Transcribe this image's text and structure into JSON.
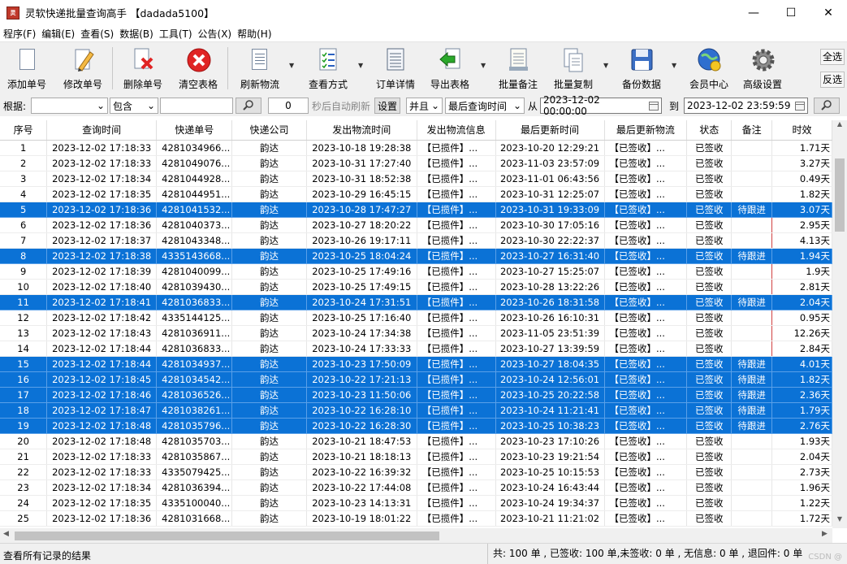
{
  "window": {
    "title": "灵软快递批量查询高手 【dadada5100】",
    "app_icon": "app-icon",
    "buttons": {
      "minimize": "—",
      "maximize": "☐",
      "close": "✕"
    }
  },
  "menu": [
    "程序(F)",
    "编辑(E)",
    "查看(S)",
    "数据(B)",
    "工具(T)",
    "公告(X)",
    "帮助(H)"
  ],
  "toolbar": {
    "buttons": [
      {
        "label": "添加单号",
        "icon": "add-document-icon"
      },
      {
        "label": "修改单号",
        "icon": "edit-pencil-icon"
      },
      {
        "label": "删除单号",
        "icon": "delete-document-icon"
      },
      {
        "label": "清空表格",
        "icon": "clear-red-x-icon"
      },
      {
        "label": "刷新物流",
        "icon": "refresh-list-icon"
      },
      {
        "label": "查看方式",
        "icon": "checklist-icon"
      },
      {
        "label": "订单详情",
        "icon": "order-detail-icon"
      },
      {
        "label": "导出表格",
        "icon": "export-arrow-icon"
      },
      {
        "label": "批量备注",
        "icon": "notes-icon"
      },
      {
        "label": "批量复制",
        "icon": "copy-icon"
      },
      {
        "label": "备份数据",
        "icon": "floppy-disk-icon"
      },
      {
        "label": "会员中心",
        "icon": "globe-member-icon"
      },
      {
        "label": "高级设置",
        "icon": "gear-icon"
      }
    ],
    "side_buttons": {
      "select_all": "全选",
      "invert": "反选"
    }
  },
  "filter": {
    "basis_label": "根据:",
    "basis_value": "",
    "match_mode": "包含",
    "search_text": "",
    "refresh_seconds": "0",
    "auto_refresh_label": "秒后自动刷新",
    "settings_button": "设置",
    "logic": "并且",
    "field": "最后查询时间",
    "from_label": "从",
    "from_value": "2023-12-02 00:00:00",
    "to_label": "到",
    "to_value": "2023-12-02 23:59:59"
  },
  "table": {
    "columns": [
      "序号",
      "查询时间",
      "快递单号",
      "快递公司",
      "发出物流时间",
      "发出物流信息",
      "最后更新时间",
      "最后更新物流",
      "状态",
      "备注",
      "时效"
    ],
    "rows": [
      {
        "no": "1",
        "query": "2023-12-02 17:18:33",
        "track": "4281034966...",
        "co": "韵达",
        "sent": "2023-10-18 19:28:38",
        "sinfo": "【已揽件】...",
        "upd": "2023-10-20 12:29:21",
        "uinfo": "【已签收】...",
        "status": "已签收",
        "note": "",
        "age": "1.71天",
        "sel": false
      },
      {
        "no": "2",
        "query": "2023-12-02 17:18:33",
        "track": "4281049076...",
        "co": "韵达",
        "sent": "2023-10-31 17:27:40",
        "sinfo": "【已揽件】...",
        "upd": "2023-11-03 23:57:09",
        "uinfo": "【已签收】...",
        "status": "已签收",
        "note": "",
        "age": "3.27天",
        "sel": false
      },
      {
        "no": "3",
        "query": "2023-12-02 17:18:34",
        "track": "4281044928...",
        "co": "韵达",
        "sent": "2023-10-31 18:52:38",
        "sinfo": "【已揽件】...",
        "upd": "2023-11-01 06:43:56",
        "uinfo": "【已签收】...",
        "status": "已签收",
        "note": "",
        "age": "0.49天",
        "sel": false
      },
      {
        "no": "4",
        "query": "2023-12-02 17:18:35",
        "track": "4281044951...",
        "co": "韵达",
        "sent": "2023-10-29 16:45:15",
        "sinfo": "【已揽件】...",
        "upd": "2023-10-31 12:25:07",
        "uinfo": "【已签收】...",
        "status": "已签收",
        "note": "",
        "age": "1.82天",
        "sel": false
      },
      {
        "no": "5",
        "query": "2023-12-02 17:18:36",
        "track": "4281041532...",
        "co": "韵达",
        "sent": "2023-10-28 17:47:27",
        "sinfo": "【已揽件】...",
        "upd": "2023-10-31 19:33:09",
        "uinfo": "【已签收】...",
        "status": "已签收",
        "note": "待跟进",
        "age": "3.07天",
        "sel": true
      },
      {
        "no": "6",
        "query": "2023-12-02 17:18:36",
        "track": "4281040373...",
        "co": "韵达",
        "sent": "2023-10-27 18:20:22",
        "sinfo": "【已揽件】...",
        "upd": "2023-10-30 17:05:16",
        "uinfo": "【已签收】...",
        "status": "已签收",
        "note": "",
        "age": "2.95天",
        "sel": false
      },
      {
        "no": "7",
        "query": "2023-12-02 17:18:37",
        "track": "4281043348...",
        "co": "韵达",
        "sent": "2023-10-26 19:17:11",
        "sinfo": "【已揽件】...",
        "upd": "2023-10-30 22:22:37",
        "uinfo": "【已签收】...",
        "status": "已签收",
        "note": "",
        "age": "4.13天",
        "sel": false
      },
      {
        "no": "8",
        "query": "2023-12-02 17:18:38",
        "track": "4335143668...",
        "co": "韵达",
        "sent": "2023-10-25 18:04:24",
        "sinfo": "【已揽件】...",
        "upd": "2023-10-27 16:31:40",
        "uinfo": "【已签收】...",
        "status": "已签收",
        "note": "待跟进",
        "age": "1.94天",
        "sel": true
      },
      {
        "no": "9",
        "query": "2023-12-02 17:18:39",
        "track": "4281040099...",
        "co": "韵达",
        "sent": "2023-10-25 17:49:16",
        "sinfo": "【已揽件】...",
        "upd": "2023-10-27 15:25:07",
        "uinfo": "【已签收】...",
        "status": "已签收",
        "note": "",
        "age": "1.9天",
        "sel": false
      },
      {
        "no": "10",
        "query": "2023-12-02 17:18:40",
        "track": "4281039430...",
        "co": "韵达",
        "sent": "2023-10-25 17:49:15",
        "sinfo": "【已揽件】...",
        "upd": "2023-10-28 13:22:26",
        "uinfo": "【已签收】...",
        "status": "已签收",
        "note": "",
        "age": "2.81天",
        "sel": false
      },
      {
        "no": "11",
        "query": "2023-12-02 17:18:41",
        "track": "4281036833...",
        "co": "韵达",
        "sent": "2023-10-24 17:31:51",
        "sinfo": "【已揽件】...",
        "upd": "2023-10-26 18:31:58",
        "uinfo": "【已签收】...",
        "status": "已签收",
        "note": "待跟进",
        "age": "2.04天",
        "sel": true
      },
      {
        "no": "12",
        "query": "2023-12-02 17:18:42",
        "track": "4335144125...",
        "co": "韵达",
        "sent": "2023-10-25 17:16:40",
        "sinfo": "【已揽件】...",
        "upd": "2023-10-26 16:10:31",
        "uinfo": "【已签收】...",
        "status": "已签收",
        "note": "",
        "age": "0.95天",
        "sel": false
      },
      {
        "no": "13",
        "query": "2023-12-02 17:18:43",
        "track": "4281036911...",
        "co": "韵达",
        "sent": "2023-10-24 17:34:38",
        "sinfo": "【已揽件】...",
        "upd": "2023-11-05 23:51:39",
        "uinfo": "【已签收】...",
        "status": "已签收",
        "note": "",
        "age": "12.26天",
        "sel": false
      },
      {
        "no": "14",
        "query": "2023-12-02 17:18:44",
        "track": "4281036833...",
        "co": "韵达",
        "sent": "2023-10-24 17:33:33",
        "sinfo": "【已揽件】...",
        "upd": "2023-10-27 13:39:59",
        "uinfo": "【已签收】...",
        "status": "已签收",
        "note": "",
        "age": "2.84天",
        "sel": false
      },
      {
        "no": "15",
        "query": "2023-12-02 17:18:44",
        "track": "4281034937...",
        "co": "韵达",
        "sent": "2023-10-23 17:50:09",
        "sinfo": "【已揽件】...",
        "upd": "2023-10-27 18:04:35",
        "uinfo": "【已签收】...",
        "status": "已签收",
        "note": "待跟进",
        "age": "4.01天",
        "sel": true
      },
      {
        "no": "16",
        "query": "2023-12-02 17:18:45",
        "track": "4281034542...",
        "co": "韵达",
        "sent": "2023-10-22 17:21:13",
        "sinfo": "【已揽件】...",
        "upd": "2023-10-24 12:56:01",
        "uinfo": "【已签收】...",
        "status": "已签收",
        "note": "待跟进",
        "age": "1.82天",
        "sel": true
      },
      {
        "no": "17",
        "query": "2023-12-02 17:18:46",
        "track": "4281036526...",
        "co": "韵达",
        "sent": "2023-10-23 11:50:06",
        "sinfo": "【已揽件】...",
        "upd": "2023-10-25 20:22:58",
        "uinfo": "【已签收】...",
        "status": "已签收",
        "note": "待跟进",
        "age": "2.36天",
        "sel": true
      },
      {
        "no": "18",
        "query": "2023-12-02 17:18:47",
        "track": "4281038261...",
        "co": "韵达",
        "sent": "2023-10-22 16:28:10",
        "sinfo": "【已揽件】...",
        "upd": "2023-10-24 11:21:41",
        "uinfo": "【已签收】...",
        "status": "已签收",
        "note": "待跟进",
        "age": "1.79天",
        "sel": true
      },
      {
        "no": "19",
        "query": "2023-12-02 17:18:48",
        "track": "4281035796...",
        "co": "韵达",
        "sent": "2023-10-22 16:28:30",
        "sinfo": "【已揽件】...",
        "upd": "2023-10-25 10:38:23",
        "uinfo": "【已签收】...",
        "status": "已签收",
        "note": "待跟进",
        "age": "2.76天",
        "sel": true
      },
      {
        "no": "20",
        "query": "2023-12-02 17:18:48",
        "track": "4281035703...",
        "co": "韵达",
        "sent": "2023-10-21 18:47:53",
        "sinfo": "【已揽件】...",
        "upd": "2023-10-23 17:10:26",
        "uinfo": "【已签收】...",
        "status": "已签收",
        "note": "",
        "age": "1.93天",
        "sel": false
      },
      {
        "no": "21",
        "query": "2023-12-02 17:18:33",
        "track": "4281035867...",
        "co": "韵达",
        "sent": "2023-10-21 18:18:13",
        "sinfo": "【已揽件】...",
        "upd": "2023-10-23 19:21:54",
        "uinfo": "【已签收】...",
        "status": "已签收",
        "note": "",
        "age": "2.04天",
        "sel": false
      },
      {
        "no": "22",
        "query": "2023-12-02 17:18:33",
        "track": "4335079425...",
        "co": "韵达",
        "sent": "2023-10-22 16:39:32",
        "sinfo": "【已揽件】...",
        "upd": "2023-10-25 10:15:53",
        "uinfo": "【已签收】...",
        "status": "已签收",
        "note": "",
        "age": "2.73天",
        "sel": false
      },
      {
        "no": "23",
        "query": "2023-12-02 17:18:34",
        "track": "4281036394...",
        "co": "韵达",
        "sent": "2023-10-22 17:44:08",
        "sinfo": "【已揽件】...",
        "upd": "2023-10-24 16:43:44",
        "uinfo": "【已签收】...",
        "status": "已签收",
        "note": "",
        "age": "1.96天",
        "sel": false
      },
      {
        "no": "24",
        "query": "2023-12-02 17:18:35",
        "track": "4335100040...",
        "co": "韵达",
        "sent": "2023-10-23 14:13:31",
        "sinfo": "【已揽件】...",
        "upd": "2023-10-24 19:34:37",
        "uinfo": "【已签收】...",
        "status": "已签收",
        "note": "",
        "age": "1.22天",
        "sel": false
      },
      {
        "no": "25",
        "query": "2023-12-02 17:18:36",
        "track": "4281031668...",
        "co": "韵达",
        "sent": "2023-10-19 18:01:22",
        "sinfo": "【已揽件】...",
        "upd": "2023-10-21 11:21:02",
        "uinfo": "【已签收】...",
        "status": "已签收",
        "note": "",
        "age": "1.72天",
        "sel": false
      }
    ]
  },
  "status": {
    "left": "查看所有记录的结果",
    "right": "共: 100 单 , 已签收:  100 单,未签收:  0 单 , 无信息: 0 单 , 退回件: 0 单",
    "watermark": "CSDN @"
  },
  "colors": {
    "selection": "#0b72d6",
    "note_border": "#d04040",
    "delete_red": "#e02424"
  }
}
